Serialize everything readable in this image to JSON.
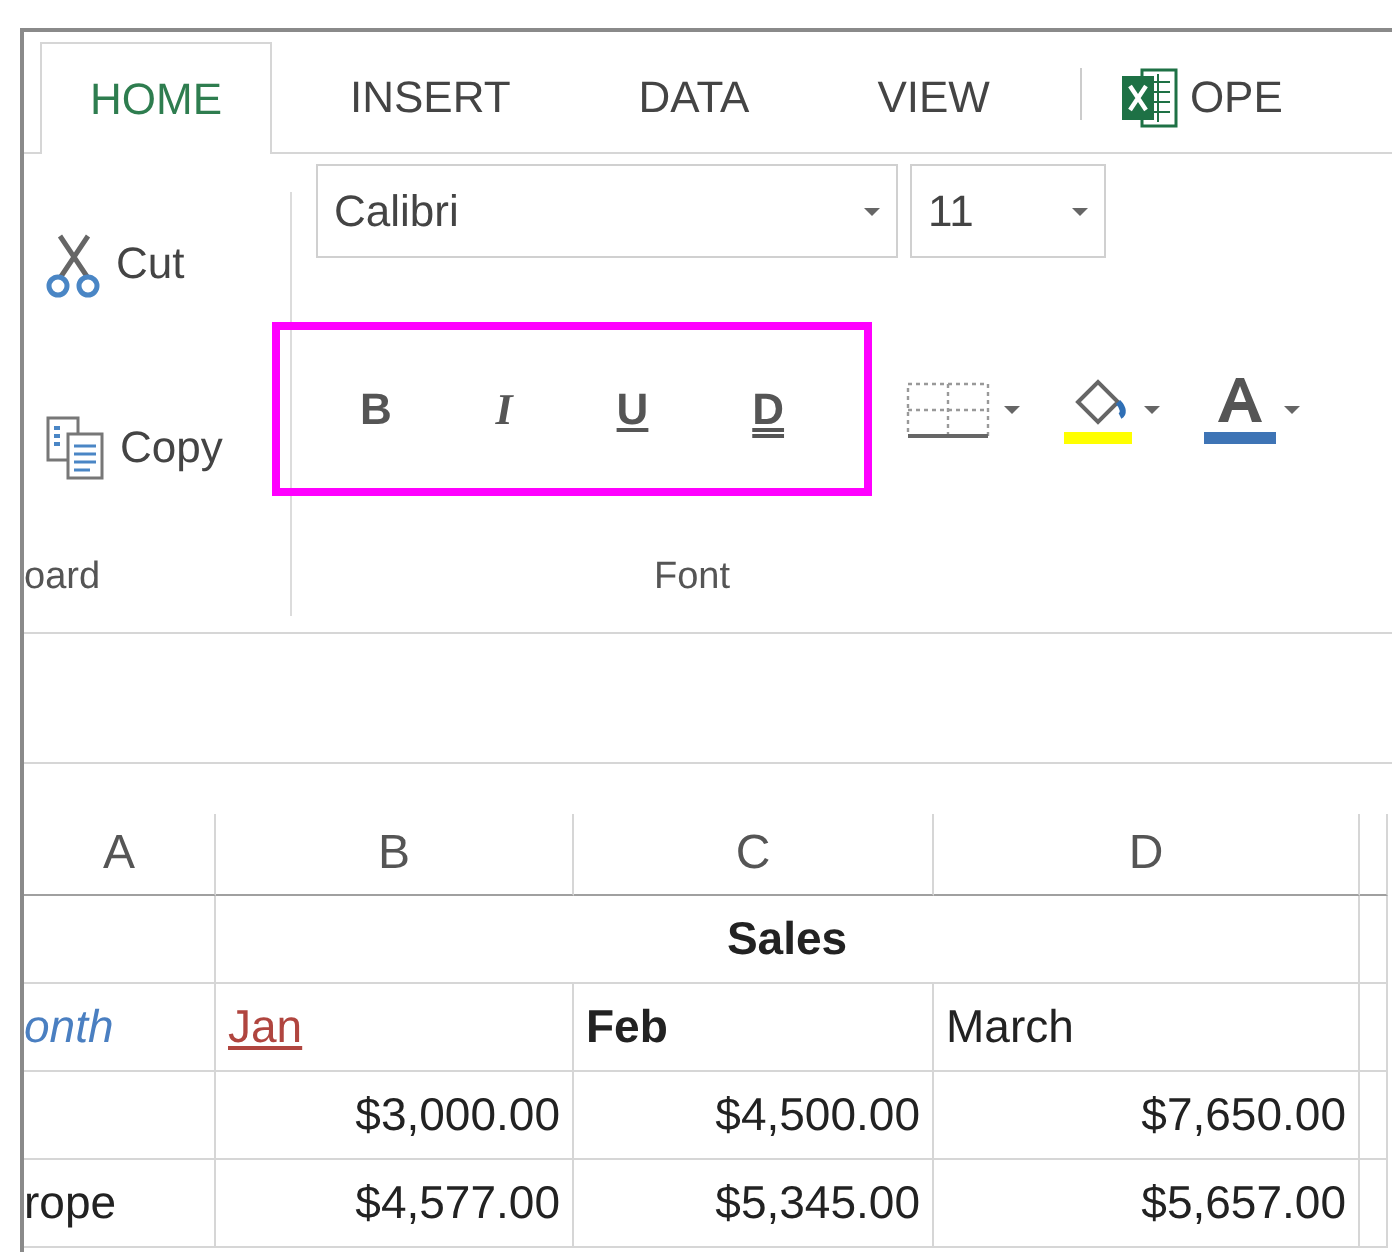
{
  "tabs": [
    {
      "label": "HOME",
      "selected": true
    },
    {
      "label": "INSERT",
      "selected": false
    },
    {
      "label": "DATA",
      "selected": false
    },
    {
      "label": "VIEW",
      "selected": false
    }
  ],
  "app_button": {
    "label": "OPE"
  },
  "clipboard": {
    "label": "oard",
    "commands": [
      {
        "label": "Cut",
        "kind": "cut"
      },
      {
        "label": "Copy",
        "kind": "copy"
      }
    ]
  },
  "font_group": {
    "label": "Font",
    "font_name": "Calibri",
    "font_size": "11",
    "highlighted": true,
    "format_buttons": [
      {
        "label": "B",
        "kind": "bold"
      },
      {
        "label": "I",
        "kind": "italic"
      },
      {
        "label": "U",
        "kind": "underline"
      },
      {
        "label": "D",
        "kind": "double-underline"
      }
    ],
    "tools": [
      {
        "kind": "borders"
      },
      {
        "kind": "fill"
      },
      {
        "kind": "font-color"
      }
    ]
  },
  "sheet": {
    "columns": [
      "A",
      "B",
      "C",
      "D"
    ],
    "rows": [
      {
        "merged_title": "Sales"
      },
      {
        "cells": [
          {
            "text": "onth",
            "kind": "italic",
            "color": "#4a7fc1"
          },
          {
            "text": "Jan",
            "kind": "underline",
            "color": "#b0453f"
          },
          {
            "text": "Feb",
            "kind": "bold"
          },
          {
            "text": "March",
            "kind": "text"
          }
        ]
      },
      {
        "cells": [
          null,
          {
            "text": "$3,000.00",
            "kind": "number"
          },
          {
            "text": "$4,500.00",
            "kind": "number"
          },
          {
            "text": "$7,650.00",
            "kind": "number"
          }
        ]
      },
      {
        "cells": [
          {
            "text": "rope",
            "kind": "text"
          },
          {
            "text": "$4,577.00",
            "kind": "number"
          },
          {
            "text": "$5,345.00",
            "kind": "number"
          },
          {
            "text": "$5,657.00",
            "kind": "number"
          }
        ]
      }
    ]
  }
}
